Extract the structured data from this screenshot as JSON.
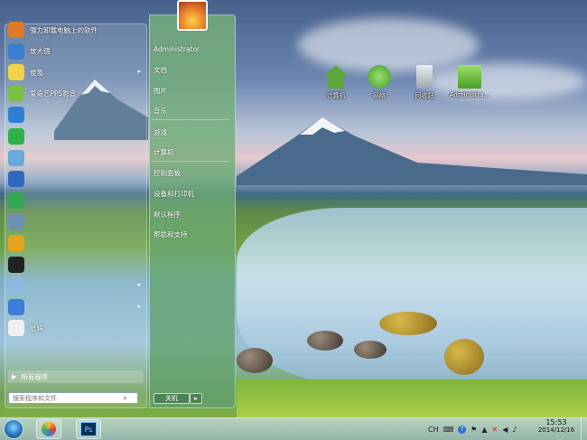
{
  "desktop": {
    "icons": [
      {
        "label": "计算机",
        "icon": "computer-icon",
        "color": "#5aa83a"
      },
      {
        "label": "网络",
        "icon": "network-globe-icon",
        "color": "#3e9a2e"
      },
      {
        "label": "回收站",
        "icon": "recycle-bin-icon",
        "color": "#c9d2d8"
      },
      {
        "label": "Administra...",
        "icon": "user-folder-icon",
        "color": "#6bbf3a"
      }
    ]
  },
  "start_menu": {
    "apps": [
      {
        "label": "强力卸载电脑上的软件",
        "icon": "uninstall-icon",
        "color": "#e07a28",
        "has_arrow": false
      },
      {
        "label": "放大镜",
        "icon": "magnifier-icon",
        "color": "#3a7fd0",
        "has_arrow": false
      },
      {
        "label": "便笺",
        "icon": "sticky-note-icon",
        "color": "#f2d24a",
        "has_arrow": true
      },
      {
        "label": "爱奇艺PPS影音",
        "icon": "pps-player-icon",
        "color": "#7ac142",
        "has_arrow": false
      },
      {
        "label": "",
        "icon": "ie-browser-icon",
        "color": "#2f7fd6",
        "has_arrow": false
      },
      {
        "label": "",
        "icon": "360-browser-icon",
        "color": "#2fb04a",
        "has_arrow": false
      },
      {
        "label": "",
        "icon": "notepad-icon",
        "color": "#6aa9d9",
        "has_arrow": false
      },
      {
        "label": "",
        "icon": "sogou-icon",
        "color": "#2f68c0",
        "has_arrow": false
      },
      {
        "label": "",
        "icon": "add-program-icon",
        "color": "#34a853",
        "has_arrow": false
      },
      {
        "label": "",
        "icon": "calculator-icon",
        "color": "#6d8fb0",
        "has_arrow": false
      },
      {
        "label": "",
        "icon": "chrome-icon",
        "color": "#e6a31e",
        "has_arrow": false
      },
      {
        "label": "",
        "icon": "cmd-icon",
        "color": "#222222",
        "has_arrow": false
      },
      {
        "label": "",
        "icon": "document-icon",
        "color": "#8fb8de",
        "has_arrow": true
      },
      {
        "label": "",
        "icon": "remote-desktop-icon",
        "color": "#3b7dd8",
        "has_arrow": true
      },
      {
        "label": "纸牌",
        "icon": "solitaire-icon",
        "color": "#f0f0f0",
        "has_arrow": false
      }
    ],
    "all_programs_label": "所有程序",
    "search_placeholder": "搜索程序和文件",
    "right_items": [
      {
        "label": "Administrator"
      },
      {
        "label": "文档"
      },
      {
        "label": "图片"
      },
      {
        "label": "音乐"
      },
      {
        "label": "游戏"
      },
      {
        "label": "计算机"
      },
      {
        "label": "控制面板"
      },
      {
        "label": "设备和打印机"
      },
      {
        "label": "默认程序"
      },
      {
        "label": "帮助和支持"
      }
    ],
    "shutdown_label": "关机",
    "shutdown_arrow": "▸"
  },
  "taskbar": {
    "pinned": [
      {
        "icon": "paint-icon",
        "color": "#f2c13a"
      },
      {
        "icon": "photoshop-icon",
        "label": "Ps",
        "color": "#0c2d54"
      }
    ],
    "tray": {
      "lang": "CH",
      "items": [
        "keyboard-icon",
        "help-icon",
        "flag-icon",
        "network-icon",
        "x-icon",
        "speaker-icon",
        "sound-icon"
      ]
    },
    "clock": {
      "time": "15:53",
      "date": "2014/12/16"
    }
  }
}
